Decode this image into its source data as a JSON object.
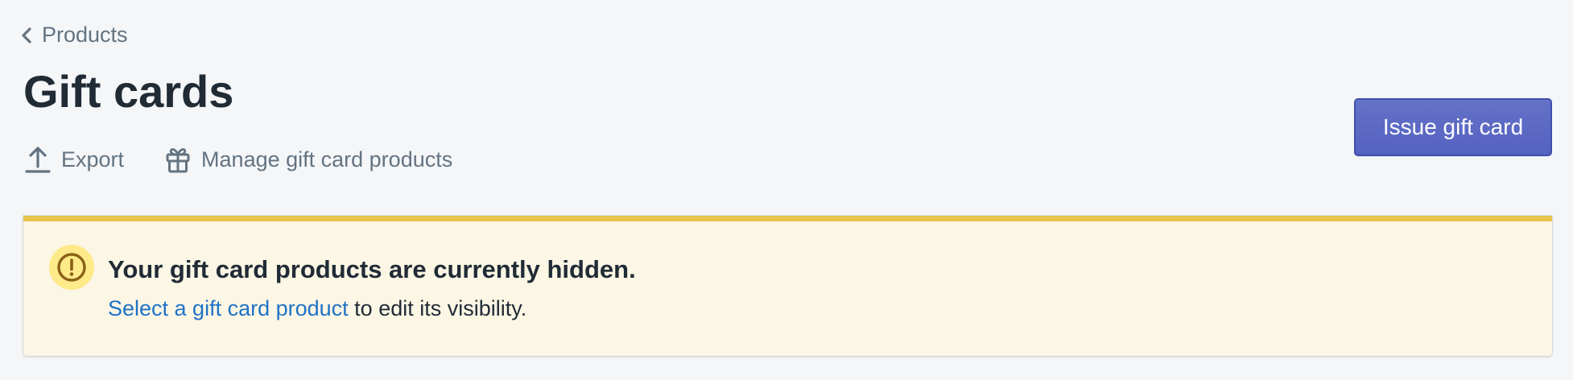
{
  "breadcrumb": {
    "label": "Products",
    "icon": "chevron-left-icon"
  },
  "page": {
    "title": "Gift cards"
  },
  "actions": [
    {
      "label": "Export",
      "icon": "export-icon"
    },
    {
      "label": "Manage gift card products",
      "icon": "gift-icon"
    }
  ],
  "primary_action": {
    "label": "Issue gift card"
  },
  "banner": {
    "status": "warning",
    "icon": "alert-circle-icon",
    "title": "Your gift card products are currently hidden.",
    "link_text": "Select a gift card product",
    "body_text": " to edit its visibility."
  },
  "colors": {
    "background": "#f4f6f8",
    "primary": "#5c6ac4",
    "banner_background": "#fcf6e5",
    "banner_border": "#e6c34a",
    "link": "#1f72c6",
    "subdued_text": "#637381"
  }
}
